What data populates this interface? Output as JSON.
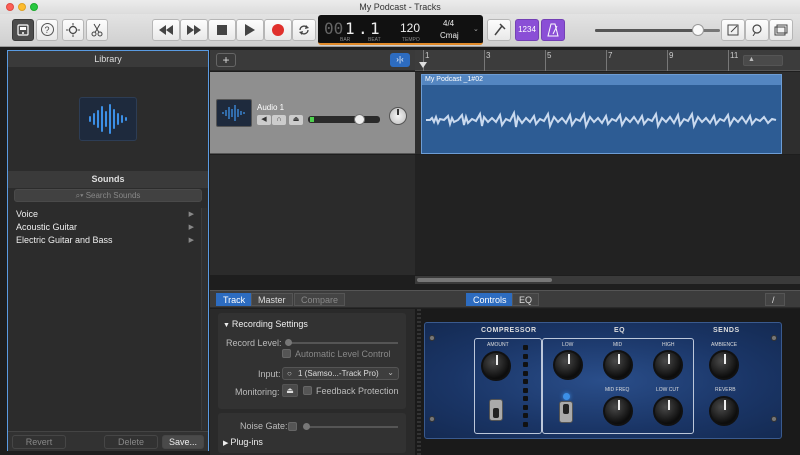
{
  "window": {
    "title": "My Podcast  - Tracks"
  },
  "colors": {
    "accent": "#2d6cc0",
    "region": "#2d5c94",
    "record": "#e0302c",
    "lcd_accent": "#e08a2a",
    "count_in": "#8a4fd6"
  },
  "toolbar": {
    "library_icon": "library-icon",
    "help_icon": "help-icon",
    "smart_controls_icon": "smart-controls-icon",
    "scissors_icon": "scissors-icon",
    "rewind_icon": "rewind-icon",
    "forward_icon": "fast-forward-icon",
    "stop_icon": "stop-icon",
    "play_icon": "play-icon",
    "record_icon": "record-icon",
    "cycle_icon": "cycle-icon",
    "tuner_icon": "tuner-icon",
    "count_in": "1234",
    "metronome_icon": "metronome-icon",
    "notepad_icon": "notepad-icon",
    "loops_icon": "loops-icon",
    "media_icon": "media-browser-icon"
  },
  "lcd": {
    "bar": "1",
    "beat": "1",
    "bar_label": "BAR",
    "beat_label": "BEAT",
    "tempo": "120",
    "tempo_label": "TEMPO",
    "signature": "4/4",
    "key": "Cmaj",
    "digits_prefix": "00"
  },
  "master_volume": 0.82,
  "library": {
    "title": "Library",
    "sounds_title": "Sounds",
    "search_placeholder": "Search Sounds",
    "categories": [
      "Voice",
      "Acoustic Guitar",
      "Electric Guitar and Bass"
    ],
    "revert": "Revert",
    "delete": "Delete",
    "save": "Save..."
  },
  "ruler": {
    "ticks": [
      "1",
      "3",
      "5",
      "7",
      "9",
      "11"
    ]
  },
  "track": {
    "name": "Audio 1",
    "region_name": "My Podcast _1#02",
    "volume": 0.72
  },
  "smart_controls": {
    "tabs": [
      "Track",
      "Master",
      "Compare"
    ],
    "view_tabs": [
      "Controls",
      "EQ"
    ],
    "recording_settings": "Recording Settings",
    "record_level": "Record Level:",
    "auto_level": "Automatic Level Control",
    "input_label": "Input:",
    "input_value": "1  (Samso...-Track Pro)",
    "monitoring_label": "Monitoring:",
    "feedback_protection": "Feedback Protection",
    "noise_gate": "Noise Gate:",
    "plugins": "Plug-ins"
  },
  "amp": {
    "compressor": "COMPRESSOR",
    "amount": "AMOUNT",
    "eq": "EQ",
    "low": "LOW",
    "mid": "MID",
    "high": "HIGH",
    "mid_freq": "MID FREQ",
    "low_cut": "LOW CUT",
    "sends": "SENDS",
    "ambience": "AMBIENCE",
    "reverb": "REVERB"
  }
}
